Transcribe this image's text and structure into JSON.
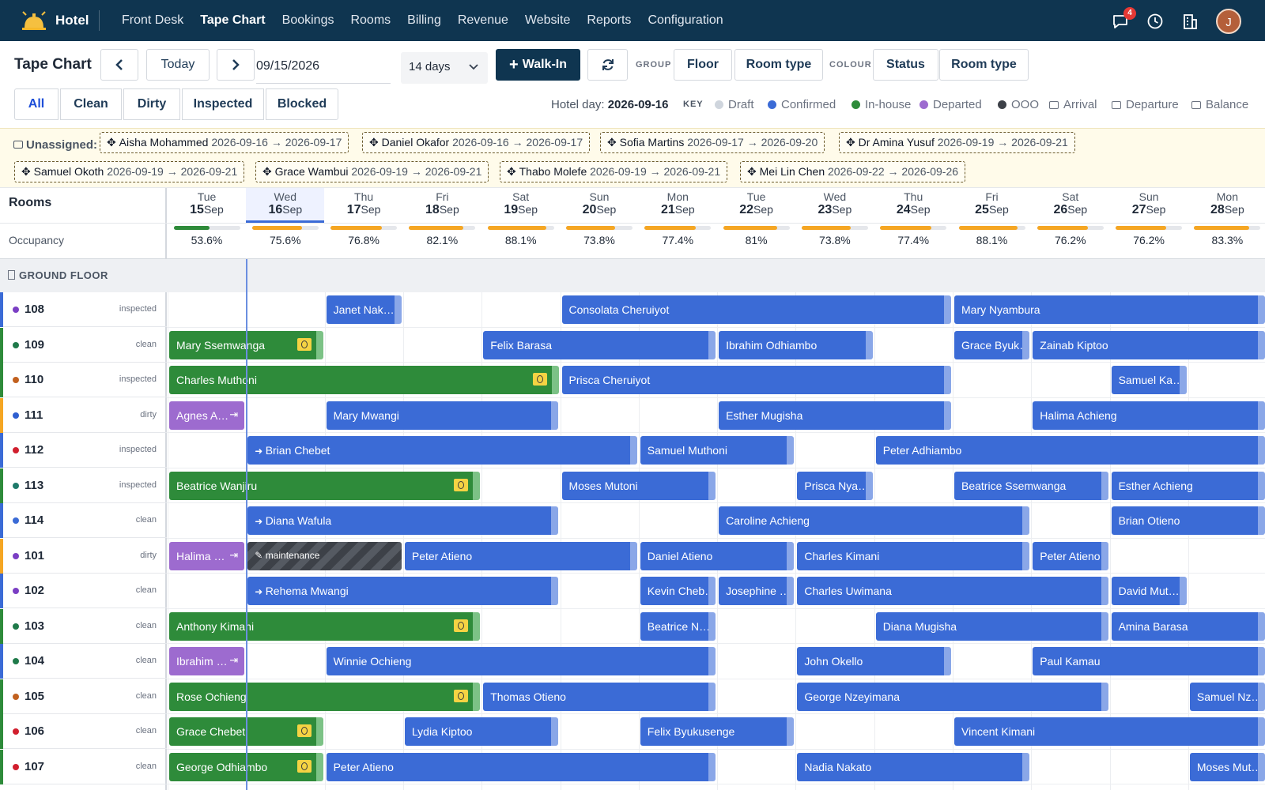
{
  "nav": {
    "brand": "Hotel",
    "links": [
      "Front Desk",
      "Tape Chart",
      "Bookings",
      "Rooms",
      "Billing",
      "Revenue",
      "Website",
      "Reports",
      "Configuration"
    ],
    "active_index": 1,
    "chat_badge": "4",
    "avatar_initial": "J"
  },
  "toolbar": {
    "title": "Tape Chart",
    "prev_label": "‹",
    "today_label": "Today",
    "next_label": "›",
    "date": "09/15/2026",
    "range": "14 days",
    "walkin_label": "Walk-In",
    "group_label": "GROUP",
    "group_options": [
      "Floor",
      "Room type"
    ],
    "colour_label": "COLOUR",
    "colour_options": [
      "Status",
      "Room type"
    ],
    "filters": [
      "All",
      "Clean",
      "Dirty",
      "Inspected",
      "Blocked"
    ],
    "hotel_day_label": "Hotel day:",
    "hotel_day": "2026-09-16",
    "key_label": "KEY",
    "key": [
      {
        "label": "Draft",
        "color": "#cfd5dd",
        "icon": "dot"
      },
      {
        "label": "Confirmed",
        "color": "#3b6bd6",
        "icon": "dot"
      },
      {
        "label": "In-house",
        "color": "#2e8b3a",
        "icon": "dot"
      },
      {
        "label": "Departed",
        "color": "#9d6bcf",
        "icon": "dot"
      },
      {
        "label": "OOO",
        "color": "#3d4148",
        "icon": "dot"
      },
      {
        "label": "Arrival",
        "color": "#6b7280",
        "icon": "arrival-icon"
      },
      {
        "label": "Departure",
        "color": "#6b7280",
        "icon": "departure-icon"
      },
      {
        "label": "Balance",
        "color": "#6b7280",
        "icon": "balance-icon"
      }
    ]
  },
  "unassigned": {
    "label": "Unassigned:",
    "chips": [
      {
        "name": "Aisha Mohammed",
        "dates": "2026-09-16 → 2026-09-17"
      },
      {
        "name": "Daniel Okafor",
        "dates": "2026-09-16 → 2026-09-17"
      },
      {
        "name": "Sofia Martins",
        "dates": "2026-09-17 → 2026-09-20"
      },
      {
        "name": "Dr Amina Yusuf",
        "dates": "2026-09-19 → 2026-09-21"
      },
      {
        "name": "Samuel Okoth",
        "dates": "2026-09-19 → 2026-09-21"
      },
      {
        "name": "Grace Wambui",
        "dates": "2026-09-19 → 2026-09-21"
      },
      {
        "name": "Thabo Molefe",
        "dates": "2026-09-19 → 2026-09-21"
      },
      {
        "name": "Mei Lin Chen",
        "dates": "2026-09-22 → 2026-09-26"
      }
    ]
  },
  "grid": {
    "rooms_label": "Rooms",
    "occupancy_label": "Occupancy",
    "floor_label": "GROUND FLOOR",
    "today_index": 1,
    "days": [
      {
        "dow": "Tue",
        "num": "15",
        "mon": "Sep",
        "occ": "53.6%",
        "occ_value": 53.6
      },
      {
        "dow": "Wed",
        "num": "16",
        "mon": "Sep",
        "occ": "75.6%",
        "occ_value": 75.6
      },
      {
        "dow": "Thu",
        "num": "17",
        "mon": "Sep",
        "occ": "76.8%",
        "occ_value": 76.8
      },
      {
        "dow": "Fri",
        "num": "18",
        "mon": "Sep",
        "occ": "82.1%",
        "occ_value": 82.1
      },
      {
        "dow": "Sat",
        "num": "19",
        "mon": "Sep",
        "occ": "88.1%",
        "occ_value": 88.1
      },
      {
        "dow": "Sun",
        "num": "20",
        "mon": "Sep",
        "occ": "73.8%",
        "occ_value": 73.8
      },
      {
        "dow": "Mon",
        "num": "21",
        "mon": "Sep",
        "occ": "77.4%",
        "occ_value": 77.4
      },
      {
        "dow": "Tue",
        "num": "22",
        "mon": "Sep",
        "occ": "81%",
        "occ_value": 81
      },
      {
        "dow": "Wed",
        "num": "23",
        "mon": "Sep",
        "occ": "73.8%",
        "occ_value": 73.8
      },
      {
        "dow": "Thu",
        "num": "24",
        "mon": "Sep",
        "occ": "77.4%",
        "occ_value": 77.4
      },
      {
        "dow": "Fri",
        "num": "25",
        "mon": "Sep",
        "occ": "88.1%",
        "occ_value": 88.1
      },
      {
        "dow": "Sat",
        "num": "26",
        "mon": "Sep",
        "occ": "76.2%",
        "occ_value": 76.2
      },
      {
        "dow": "Sun",
        "num": "27",
        "mon": "Sep",
        "occ": "76.2%",
        "occ_value": 76.2
      },
      {
        "dow": "Mon",
        "num": "28",
        "mon": "Sep",
        "occ": "83.3%",
        "occ_value": 83.3
      }
    ],
    "rooms": [
      {
        "num": "108",
        "status": "inspected",
        "dot": "#7b3fc4",
        "stripe": "#3b6bd6",
        "bookings": [
          {
            "guest": "Janet Nak…",
            "start": 2,
            "nights": 1,
            "state": "confirmed"
          },
          {
            "guest": "Consolata Cheruiyot",
            "start": 5,
            "nights": 5,
            "state": "confirmed"
          },
          {
            "guest": "Mary Nyambura",
            "start": 10,
            "nights": 4,
            "state": "confirmed"
          }
        ]
      },
      {
        "num": "109",
        "status": "clean",
        "dot": "#1f7a4a",
        "stripe": "#2e8b3a",
        "bookings": [
          {
            "guest": "Mary Ssemwanga",
            "start": 0,
            "nights": 2,
            "state": "inhouse",
            "balance": true
          },
          {
            "guest": "Felix Barasa",
            "start": 4,
            "nights": 3,
            "state": "confirmed"
          },
          {
            "guest": "Ibrahim Odhiambo",
            "start": 7,
            "nights": 2,
            "state": "confirmed"
          },
          {
            "guest": "Grace Byuk…",
            "start": 10,
            "nights": 1,
            "state": "confirmed"
          },
          {
            "guest": "Zainab Kiptoo",
            "start": 11,
            "nights": 3,
            "state": "confirmed"
          }
        ]
      },
      {
        "num": "110",
        "status": "inspected",
        "dot": "#c2611f",
        "stripe": "#2e8b3a",
        "bookings": [
          {
            "guest": "Charles Muthoni",
            "start": 0,
            "nights": 5,
            "state": "inhouse",
            "balance": true
          },
          {
            "guest": "Prisca Cheruiyot",
            "start": 5,
            "nights": 5,
            "state": "confirmed"
          },
          {
            "guest": "Samuel Ka…",
            "start": 12,
            "nights": 1,
            "state": "confirmed"
          }
        ]
      },
      {
        "num": "111",
        "status": "dirty",
        "dot": "#2f5fd0",
        "stripe": "#f5a623",
        "bookings": [
          {
            "guest": "Agnes A…",
            "start": 0,
            "nights": 1,
            "state": "departed",
            "departure": true
          },
          {
            "guest": "Mary Mwangi",
            "start": 2,
            "nights": 3,
            "state": "confirmed"
          },
          {
            "guest": "Esther Mugisha",
            "start": 7,
            "nights": 3,
            "state": "confirmed"
          },
          {
            "guest": "Halima Achieng",
            "start": 11,
            "nights": 3,
            "state": "confirmed"
          }
        ]
      },
      {
        "num": "112",
        "status": "inspected",
        "dot": "#d11f2e",
        "stripe": "#3b6bd6",
        "bookings": [
          {
            "guest": "Brian Chebet",
            "start": 1,
            "nights": 5,
            "state": "confirmed",
            "arrival": true
          },
          {
            "guest": "Samuel Muthoni",
            "start": 6,
            "nights": 2,
            "state": "confirmed"
          },
          {
            "guest": "Peter Adhiambo",
            "start": 9,
            "nights": 5,
            "state": "confirmed"
          }
        ]
      },
      {
        "num": "113",
        "status": "inspected",
        "dot": "#1f7a6a",
        "stripe": "#2e8b3a",
        "bookings": [
          {
            "guest": "Beatrice Wanjiru",
            "start": 0,
            "nights": 4,
            "state": "inhouse",
            "balance": true
          },
          {
            "guest": "Moses Mutoni",
            "start": 5,
            "nights": 2,
            "state": "confirmed"
          },
          {
            "guest": "Prisca Nya…",
            "start": 8,
            "nights": 1,
            "state": "confirmed"
          },
          {
            "guest": "Beatrice Ssemwanga",
            "start": 10,
            "nights": 2,
            "state": "confirmed"
          },
          {
            "guest": "Esther Achieng",
            "start": 12,
            "nights": 2,
            "state": "confirmed"
          }
        ]
      },
      {
        "num": "114",
        "status": "clean",
        "dot": "#3b6bd6",
        "stripe": "#3b6bd6",
        "bookings": [
          {
            "guest": "Diana Wafula",
            "start": 1,
            "nights": 4,
            "state": "confirmed",
            "arrival": true
          },
          {
            "guest": "Caroline Achieng",
            "start": 7,
            "nights": 4,
            "state": "confirmed"
          },
          {
            "guest": "Brian Otieno",
            "start": 12,
            "nights": 2,
            "state": "confirmed"
          }
        ]
      },
      {
        "num": "101",
        "status": "dirty",
        "dot": "#7b3fc4",
        "stripe": "#f5a623",
        "bookings": [
          {
            "guest": "Halima …",
            "start": 0,
            "nights": 1,
            "state": "departed",
            "departure": true
          },
          {
            "guest": "maintenance",
            "start": 1,
            "nights": 2,
            "state": "ooo"
          },
          {
            "guest": "Peter Atieno",
            "start": 3,
            "nights": 3,
            "state": "confirmed"
          },
          {
            "guest": "Daniel Atieno",
            "start": 6,
            "nights": 2,
            "state": "confirmed"
          },
          {
            "guest": "Charles Kimani",
            "start": 8,
            "nights": 3,
            "state": "confirmed"
          },
          {
            "guest": "Peter Atieno",
            "start": 11,
            "nights": 1,
            "state": "confirmed"
          }
        ]
      },
      {
        "num": "102",
        "status": "clean",
        "dot": "#7b3fc4",
        "stripe": "#3b6bd6",
        "bookings": [
          {
            "guest": "Rehema Mwangi",
            "start": 1,
            "nights": 4,
            "state": "confirmed",
            "arrival": true
          },
          {
            "guest": "Kevin Cheb…",
            "start": 6,
            "nights": 1,
            "state": "confirmed"
          },
          {
            "guest": "Josephine …",
            "start": 7,
            "nights": 1,
            "state": "confirmed"
          },
          {
            "guest": "Charles Uwimana",
            "start": 8,
            "nights": 4,
            "state": "confirmed"
          },
          {
            "guest": "David Mut…",
            "start": 12,
            "nights": 1,
            "state": "confirmed"
          }
        ]
      },
      {
        "num": "103",
        "status": "clean",
        "dot": "#1f7a4a",
        "stripe": "#2e8b3a",
        "bookings": [
          {
            "guest": "Anthony Kimani",
            "start": 0,
            "nights": 4,
            "state": "inhouse",
            "balance": true
          },
          {
            "guest": "Beatrice N…",
            "start": 6,
            "nights": 1,
            "state": "confirmed"
          },
          {
            "guest": "Diana Mugisha",
            "start": 9,
            "nights": 3,
            "state": "confirmed"
          },
          {
            "guest": "Amina Barasa",
            "start": 12,
            "nights": 2,
            "state": "confirmed"
          }
        ]
      },
      {
        "num": "104",
        "status": "clean",
        "dot": "#1f7a4a",
        "stripe": "#3b6bd6",
        "bookings": [
          {
            "guest": "Ibrahim …",
            "start": 0,
            "nights": 1,
            "state": "departed",
            "departure": true
          },
          {
            "guest": "Winnie Ochieng",
            "start": 2,
            "nights": 5,
            "state": "confirmed"
          },
          {
            "guest": "John Okello",
            "start": 8,
            "nights": 2,
            "state": "confirmed"
          },
          {
            "guest": "Paul Kamau",
            "start": 11,
            "nights": 3,
            "state": "confirmed"
          }
        ]
      },
      {
        "num": "105",
        "status": "clean",
        "dot": "#c2611f",
        "stripe": "#2e8b3a",
        "bookings": [
          {
            "guest": "Rose Ochieng",
            "start": 0,
            "nights": 4,
            "state": "inhouse",
            "balance": true
          },
          {
            "guest": "Thomas Otieno",
            "start": 4,
            "nights": 3,
            "state": "confirmed"
          },
          {
            "guest": "George Nzeyimana",
            "start": 8,
            "nights": 4,
            "state": "confirmed"
          },
          {
            "guest": "Samuel Nz…",
            "start": 13,
            "nights": 1,
            "state": "confirmed"
          }
        ]
      },
      {
        "num": "106",
        "status": "clean",
        "dot": "#d11f2e",
        "stripe": "#2e8b3a",
        "bookings": [
          {
            "guest": "Grace Chebet",
            "start": 0,
            "nights": 2,
            "state": "inhouse",
            "balance": true
          },
          {
            "guest": "Lydia Kiptoo",
            "start": 3,
            "nights": 2,
            "state": "confirmed"
          },
          {
            "guest": "Felix Byukusenge",
            "start": 6,
            "nights": 2,
            "state": "confirmed"
          },
          {
            "guest": "Vincent Kimani",
            "start": 10,
            "nights": 4,
            "state": "confirmed"
          }
        ]
      },
      {
        "num": "107",
        "status": "clean",
        "dot": "#d11f2e",
        "stripe": "#2e8b3a",
        "bookings": [
          {
            "guest": "George Odhiambo",
            "start": 0,
            "nights": 2,
            "state": "inhouse",
            "balance": true
          },
          {
            "guest": "Peter Atieno",
            "start": 2,
            "nights": 5,
            "state": "confirmed"
          },
          {
            "guest": "Nadia Nakato",
            "start": 8,
            "nights": 3,
            "state": "confirmed"
          },
          {
            "guest": "Moses Mut…",
            "start": 13,
            "nights": 1,
            "state": "confirmed"
          }
        ]
      }
    ]
  }
}
